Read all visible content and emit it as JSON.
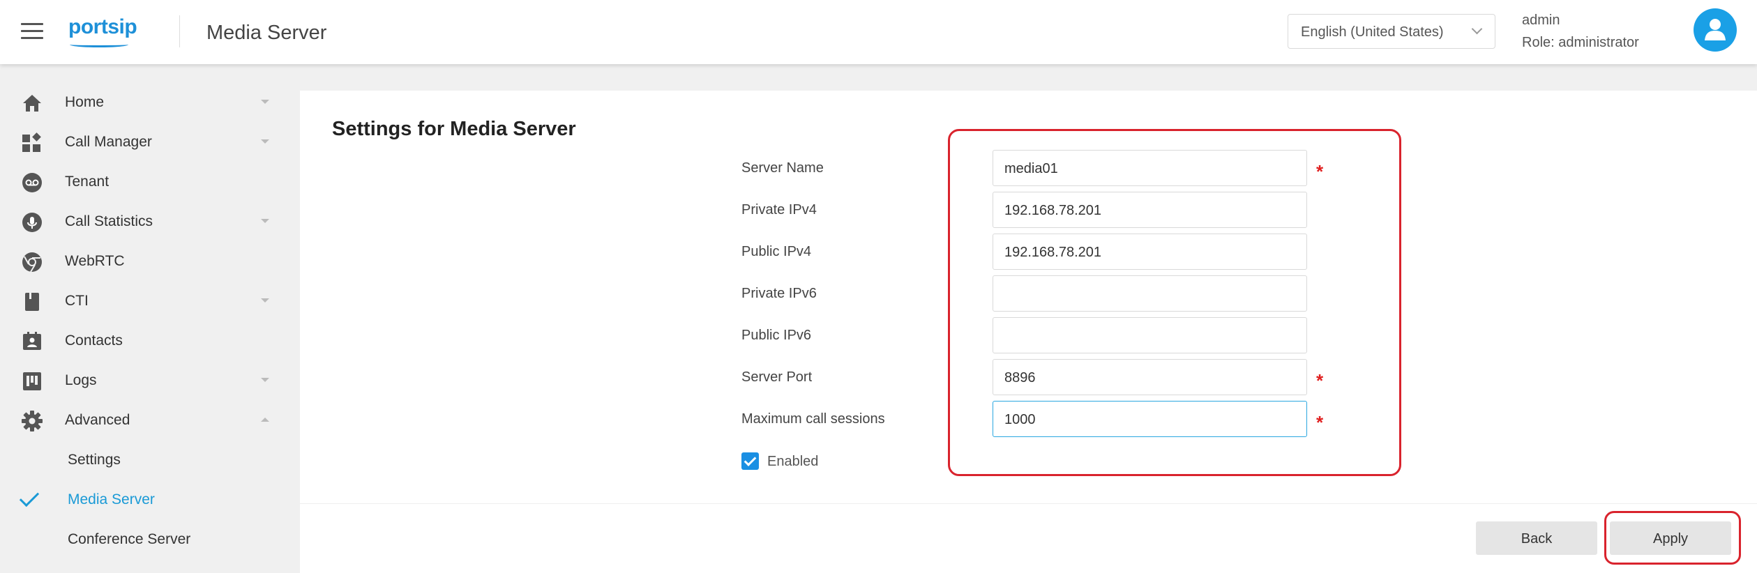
{
  "header": {
    "logo": "portsip",
    "title": "Media Server",
    "language": "English (United States)",
    "user_name": "admin",
    "user_role": "Role: administrator"
  },
  "sidebar": {
    "items": [
      {
        "label": "Home",
        "icon": "home-icon",
        "expandable": true
      },
      {
        "label": "Call Manager",
        "icon": "call-manager-icon",
        "expandable": true
      },
      {
        "label": "Tenant",
        "icon": "voicemail-icon",
        "expandable": false
      },
      {
        "label": "Call Statistics",
        "icon": "microphone-icon",
        "expandable": true
      },
      {
        "label": "WebRTC",
        "icon": "chrome-icon",
        "expandable": false
      },
      {
        "label": "CTI",
        "icon": "document-icon",
        "expandable": true
      },
      {
        "label": "Contacts",
        "icon": "contacts-icon",
        "expandable": false
      },
      {
        "label": "Logs",
        "icon": "logs-icon",
        "expandable": true
      },
      {
        "label": "Advanced",
        "icon": "gear-icon",
        "expandable": true,
        "expanded": true
      }
    ],
    "sub_items": [
      {
        "label": "Settings",
        "active": false
      },
      {
        "label": "Media Server",
        "active": true
      },
      {
        "label": "Conference Server",
        "active": false
      }
    ]
  },
  "main": {
    "title": "Settings for Media Server",
    "fields": [
      {
        "label": "Server Name",
        "value": "media01",
        "required": true
      },
      {
        "label": "Private IPv4",
        "value": "192.168.78.201",
        "required": false
      },
      {
        "label": "Public IPv4",
        "value": "192.168.78.201",
        "required": false
      },
      {
        "label": "Private IPv6",
        "value": "",
        "required": false
      },
      {
        "label": "Public IPv6",
        "value": "",
        "required": false
      },
      {
        "label": "Server Port",
        "value": "8896",
        "required": true
      },
      {
        "label": "Maximum call sessions",
        "value": "1000",
        "required": true
      }
    ],
    "required_mark": "*",
    "enabled_label": "Enabled",
    "enabled": true,
    "back_label": "Back",
    "apply_label": "Apply"
  },
  "colors": {
    "accent": "#1a9ad6",
    "highlight": "#d9232d",
    "required": "#e02020"
  }
}
